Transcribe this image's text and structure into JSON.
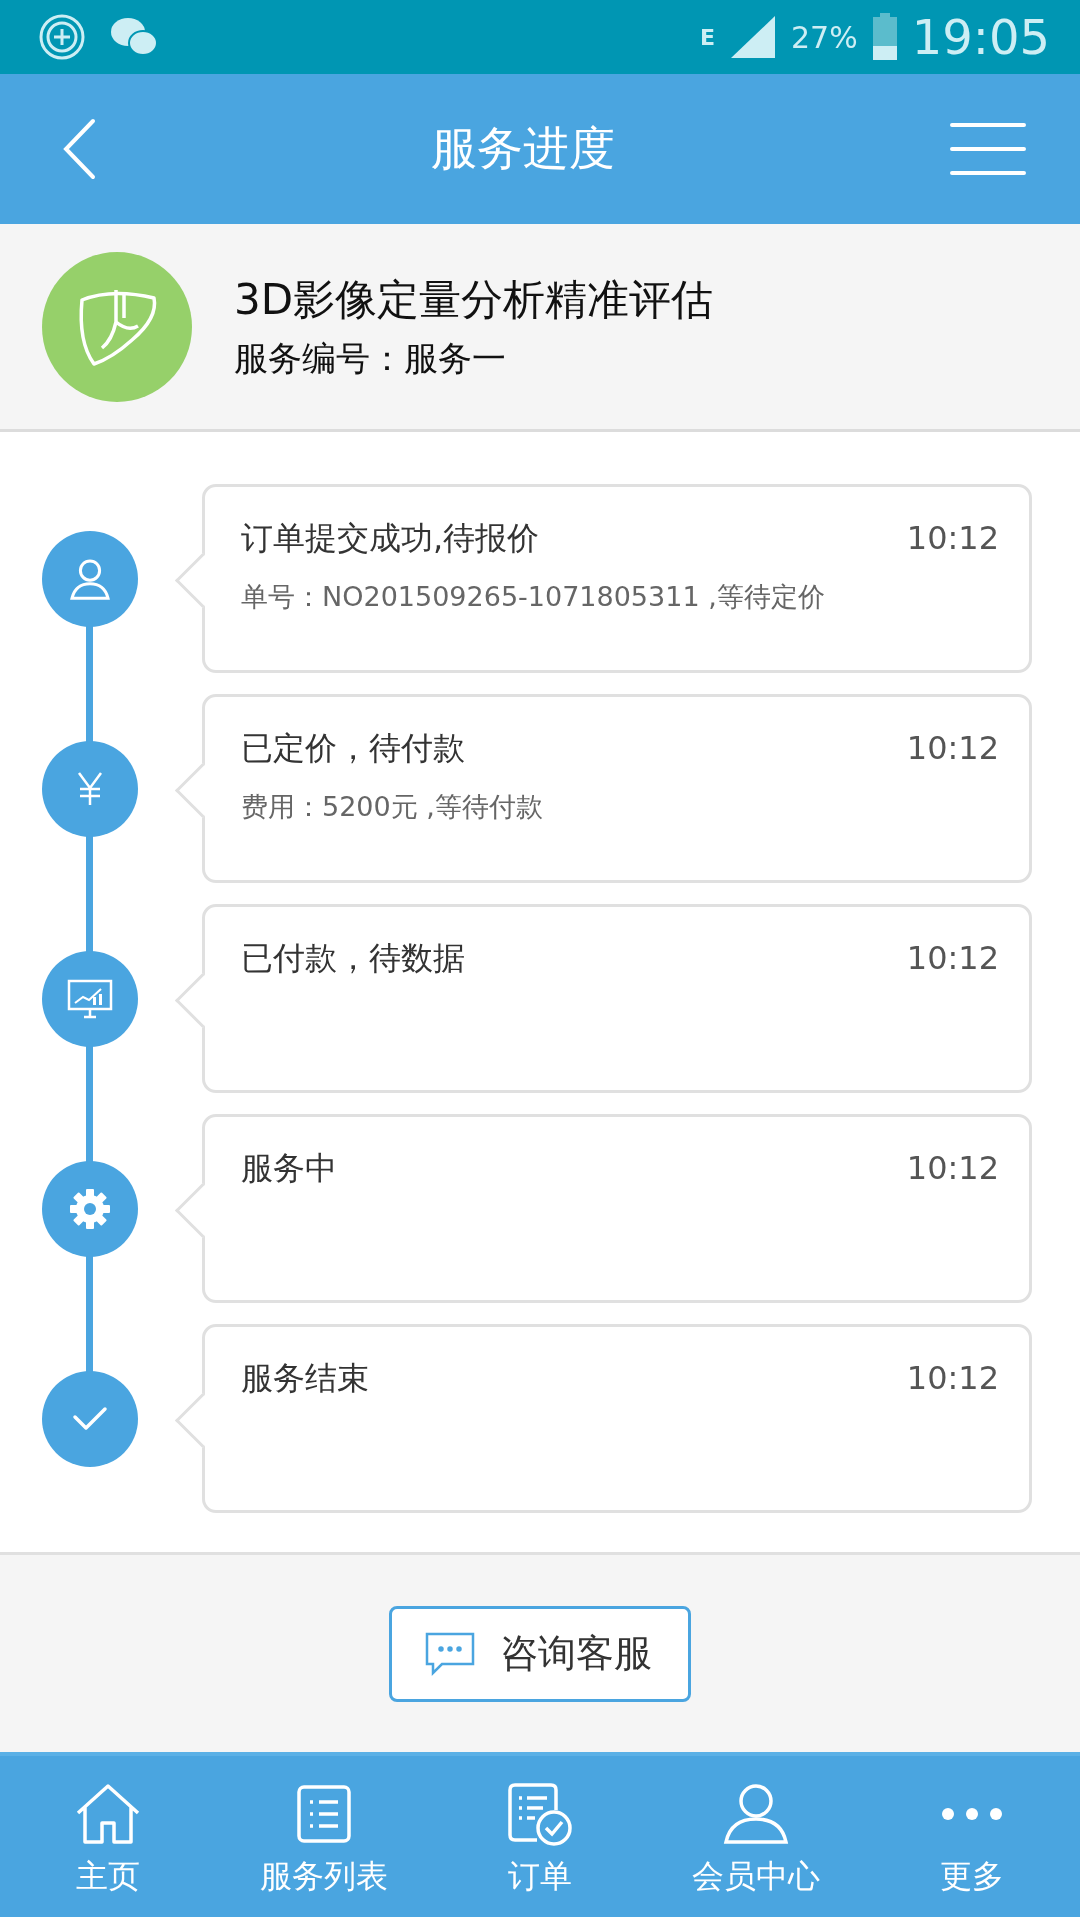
{
  "status_bar": {
    "network": "E",
    "battery": "27%",
    "time": "19:05"
  },
  "app_bar": {
    "title": "服务进度"
  },
  "service": {
    "name": "3D影像定量分析精准评估",
    "number": "服务编号：服务一"
  },
  "steps": [
    {
      "kind": "user",
      "title": "订单提交成功,待报价",
      "time": "10:12",
      "detail": "单号：NO201509265-1071805311 ,等待定价"
    },
    {
      "kind": "yen",
      "title": "已定价，待付款",
      "time": "10:12",
      "detail": "费用：5200元 ,等待付款"
    },
    {
      "kind": "monitor",
      "title": "已付款，待数据",
      "time": "10:12"
    },
    {
      "kind": "gear",
      "title": "服务中",
      "time": "10:12"
    },
    {
      "kind": "check",
      "title": "服务结束",
      "time": "10:12"
    }
  ],
  "consult_button": {
    "label": "咨询客服"
  },
  "bottom_nav": [
    {
      "kind": "home",
      "label": "主页"
    },
    {
      "kind": "list",
      "label": "服务列表"
    },
    {
      "kind": "order",
      "label": "订单"
    },
    {
      "kind": "member",
      "label": "会员中心"
    },
    {
      "kind": "more",
      "label": "更多"
    }
  ]
}
